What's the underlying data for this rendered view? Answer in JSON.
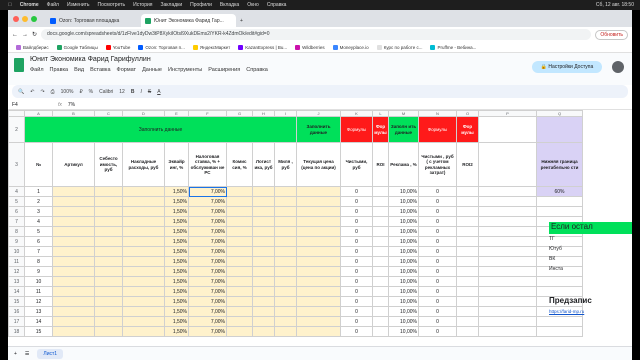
{
  "mac": {
    "app": "Chrome",
    "menu": [
      "Файл",
      "Изменить",
      "Посмотреть",
      "История",
      "Закладки",
      "Профили",
      "Вкладка",
      "Окно",
      "Справка"
    ],
    "datetime": "Сб, 12 авг. 18:50"
  },
  "tabs": [
    {
      "label": "Ozon: Торговая площадка"
    },
    {
      "label": "Юнит Экономика Фарид Гар..."
    },
    {
      "label": "+"
    }
  ],
  "url": "docs.google.com/spreadsheets/d/1zFIve1dyDw3tP8XykiIOtsl9XukDEms2/YKR-k4ZdmOk/edit#gid=0",
  "update_label": "Обновить",
  "bookmarks": [
    "Вайлдберис",
    "Google Таблицы",
    "YouTube",
    "Ozon: Торговая п...",
    "ЯндексМаркет",
    "KazanExpress | Bu...",
    "Wildberries",
    "Moneyplace.io",
    "Курс по работе с...",
    "Pruffme - Вебина..."
  ],
  "doc": {
    "title": "Юнит Экономика Фарид Гарифуллин",
    "menu": [
      "Файл",
      "Правка",
      "Вид",
      "Вставка",
      "Формат",
      "Данные",
      "Инструменты",
      "Расширения",
      "Справка"
    ],
    "access_label": "Настройки Доступа"
  },
  "toolbar": {
    "zoom": "100%",
    "font": "Calibri",
    "size": "12"
  },
  "formula": {
    "cell": "F4",
    "fx": "fx",
    "value": "7%"
  },
  "columns": [
    "A",
    "B",
    "C",
    "D",
    "E",
    "F",
    "G",
    "H",
    "I",
    "J",
    "K",
    "L",
    "M",
    "N",
    "O",
    "P",
    "Q"
  ],
  "row2": {
    "fill_data": "Заполнить данные",
    "fill_data_2": "Заполнить данные",
    "formulas": "Формулы",
    "formula_short": "Фор мулы",
    "fill_short": "Заполн ить данные",
    "formulas_2": "Формулы",
    "formula_3": "Фор мулы"
  },
  "headers": {
    "num": "№",
    "article": "Артикул",
    "cost": "Себесто имость, руб",
    "overhead": "Накладные расходы, руб",
    "acquiring": "Эквайр инг, %",
    "tax": "Налоговая ставка, % + обслуживан ие РС",
    "commission": "Комис сия, %",
    "logistics": "Логист ика, руб",
    "mile": "Миля , руб",
    "current_price": "Текущая цена (цена по акции)",
    "net": "Чистыми, руб",
    "roi": "ROI",
    "ads": "Реклама , %",
    "net_ads": "Чистыми , руб ( с учетом рекламных затрат)",
    "roi2": "ROI2",
    "lower": "Нижняя граница рентабельно сти"
  },
  "lower_value": "60%",
  "rows": [
    {
      "r": "4",
      "n": "1",
      "acq": "1,50%",
      "tax": "7,00%",
      "net": "0",
      "ads": "10,00%",
      "net2": "0"
    },
    {
      "r": "5",
      "n": "2",
      "acq": "1,50%",
      "tax": "7,00%",
      "net": "0",
      "ads": "10,00%",
      "net2": "0"
    },
    {
      "r": "6",
      "n": "3",
      "acq": "1,50%",
      "tax": "7,00%",
      "net": "0",
      "ads": "10,00%",
      "net2": "0"
    },
    {
      "r": "7",
      "n": "4",
      "acq": "1,50%",
      "tax": "7,00%",
      "net": "0",
      "ads": "10,00%",
      "net2": "0"
    },
    {
      "r": "8",
      "n": "5",
      "acq": "1,50%",
      "tax": "7,00%",
      "net": "0",
      "ads": "10,00%",
      "net2": "0"
    },
    {
      "r": "9",
      "n": "6",
      "acq": "1,50%",
      "tax": "7,00%",
      "net": "0",
      "ads": "10,00%",
      "net2": "0"
    },
    {
      "r": "10",
      "n": "7",
      "acq": "1,50%",
      "tax": "7,00%",
      "net": "0",
      "ads": "10,00%",
      "net2": "0"
    },
    {
      "r": "11",
      "n": "8",
      "acq": "1,50%",
      "tax": "7,00%",
      "net": "0",
      "ads": "10,00%",
      "net2": "0"
    },
    {
      "r": "12",
      "n": "9",
      "acq": "1,50%",
      "tax": "7,00%",
      "net": "0",
      "ads": "10,00%",
      "net2": "0"
    },
    {
      "r": "13",
      "n": "10",
      "acq": "1,50%",
      "tax": "7,00%",
      "net": "0",
      "ads": "10,00%",
      "net2": "0"
    },
    {
      "r": "14",
      "n": "11",
      "acq": "1,50%",
      "tax": "7,00%",
      "net": "0",
      "ads": "10,00%",
      "net2": "0"
    },
    {
      "r": "15",
      "n": "12",
      "acq": "1,50%",
      "tax": "7,00%",
      "net": "0",
      "ads": "10,00%",
      "net2": "0"
    },
    {
      "r": "16",
      "n": "13",
      "acq": "1,50%",
      "tax": "7,00%",
      "net": "0",
      "ads": "10,00%",
      "net2": "0"
    },
    {
      "r": "17",
      "n": "14",
      "acq": "1,50%",
      "tax": "7,00%",
      "net": "0",
      "ads": "10,00%",
      "net2": "0"
    },
    {
      "r": "18",
      "n": "15",
      "acq": "1,50%",
      "tax": "7,00%",
      "net": "0",
      "ads": "10,00%",
      "net2": "0"
    }
  ],
  "side": {
    "if_left": "Если остал",
    "tg": "ТГ",
    "yt": "Ютуб",
    "vk": "ВК",
    "insta": "Инста",
    "pre": "Предзапис",
    "link": "https://farid-mp.ru"
  },
  "sheet_tab": "Лист1",
  "colors": {
    "green": "#00e05a",
    "red": "#ff1a1a",
    "yellow": "#fff2cc"
  }
}
